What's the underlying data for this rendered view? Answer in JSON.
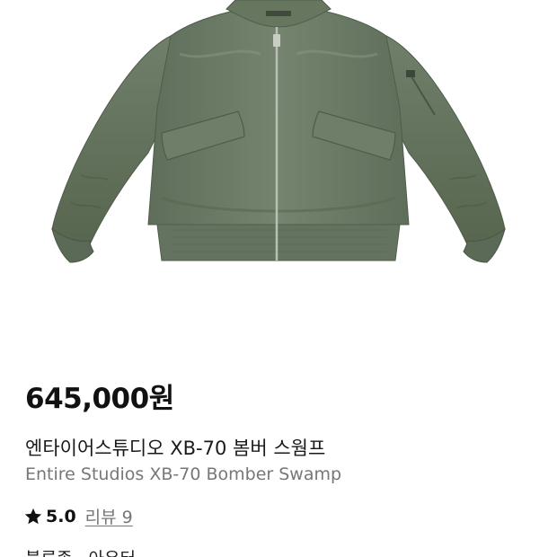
{
  "product": {
    "image_alt": "Entire Studios XB-70 Bomber Swamp jacket",
    "price": "645,000원",
    "name_ko": "엔타이어스튜디오 XB-70 봄버 스웜프",
    "name_en": "Entire Studios XB-70 Bomber Swamp",
    "rating": "5.0",
    "review_link": "리뷰 9",
    "category": "블루종 · 아우터"
  },
  "icons": {
    "rating": "star-icon"
  },
  "colors": {
    "jacket": "#6b7b66",
    "jacket_dark": "#55624f",
    "jacket_light": "#80907a",
    "price_text": "#111111",
    "secondary_text": "#777777"
  }
}
